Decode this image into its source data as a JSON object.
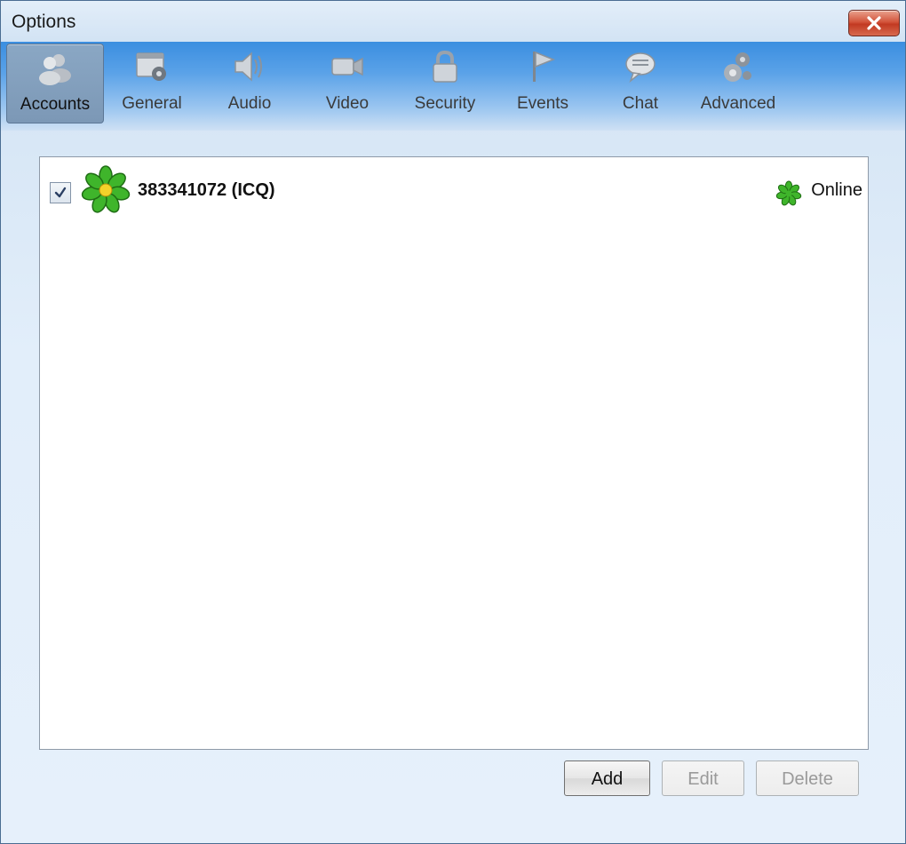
{
  "window": {
    "title": "Options"
  },
  "toolbar": {
    "items": [
      {
        "label": "Accounts",
        "icon": "accounts-icon",
        "selected": true
      },
      {
        "label": "General",
        "icon": "general-icon",
        "selected": false
      },
      {
        "label": "Audio",
        "icon": "audio-icon",
        "selected": false
      },
      {
        "label": "Video",
        "icon": "video-icon",
        "selected": false
      },
      {
        "label": "Security",
        "icon": "lock-icon",
        "selected": false
      },
      {
        "label": "Events",
        "icon": "flag-icon",
        "selected": false
      },
      {
        "label": "Chat",
        "icon": "chat-bubble-icon",
        "selected": false
      },
      {
        "label": "Advanced",
        "icon": "gears-icon",
        "selected": false
      }
    ]
  },
  "accounts": [
    {
      "name": "383341072 (ICQ)",
      "enabled": true,
      "status": "Online",
      "icon": "icq-flower-icon"
    }
  ],
  "buttons": {
    "add": "Add",
    "edit": "Edit",
    "delete": "Delete"
  },
  "colors": {
    "icq_green": "#3fb52b",
    "toolbar_blue": "#3b8ee0",
    "close_red": "#c23a22"
  }
}
